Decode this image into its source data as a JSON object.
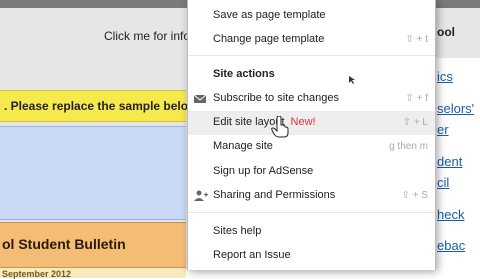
{
  "page": {
    "header_click_text": "Click me for info",
    "yellow_band_text": ". Please replace the sample below",
    "bulletin_title": "ol Student Bulletin",
    "date_text": "September 2012",
    "right_column": {
      "header": "ool",
      "links": [
        "ics",
        "selors'",
        "er",
        "dent",
        "cil",
        "heck",
        "ebac"
      ]
    }
  },
  "menu": {
    "items": [
      {
        "label": "Save as page template",
        "shortcut": "",
        "icon": ""
      },
      {
        "label": "Change page template",
        "shortcut": "⇧ + t",
        "icon": ""
      },
      {
        "label": "Site actions",
        "shortcut": "",
        "icon": "",
        "header": true
      },
      {
        "label": "Subscribe to site changes",
        "shortcut": "⇧ + f",
        "icon": "mail-icon"
      },
      {
        "label": "Edit site layout",
        "badge": "New!",
        "shortcut": "⇧ + L",
        "icon": ""
      },
      {
        "label": "Manage site",
        "shortcut": "g then m",
        "icon": ""
      },
      {
        "label": "Sign up for AdSense",
        "shortcut": "",
        "icon": ""
      },
      {
        "label": "Sharing and Permissions",
        "shortcut": "⇧ + S",
        "icon": "add-person-icon"
      },
      {
        "label": "Sites help",
        "shortcut": "",
        "icon": ""
      },
      {
        "label": "Report an Issue",
        "shortcut": "",
        "icon": ""
      }
    ]
  },
  "colors": {
    "hover_bg": "#eeeeee",
    "new_badge": "#dd3333",
    "link": "#1a5dab"
  }
}
